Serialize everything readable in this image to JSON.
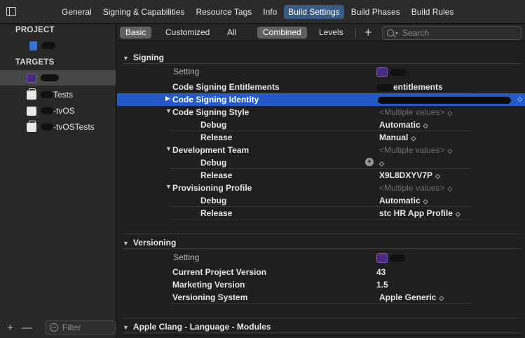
{
  "tabs": [
    "General",
    "Signing & Capabilities",
    "Resource Tags",
    "Info",
    "Build Settings",
    "Build Phases",
    "Build Rules"
  ],
  "active_tab": "Build Settings",
  "sidebar": {
    "project_header": "PROJECT",
    "targets_header": "TARGETS",
    "targets": [
      {
        "label": ""
      },
      {
        "label": "Tests"
      },
      {
        "label": "-tvOS"
      },
      {
        "label": "-tvOSTests"
      }
    ],
    "filter_placeholder": "Filter"
  },
  "filterbar": {
    "basic": "Basic",
    "customized": "Customized",
    "all": "All",
    "combined": "Combined",
    "levels": "Levels",
    "search_placeholder": "Search"
  },
  "signing": {
    "title": "Signing",
    "setting_label": "Setting",
    "entitlements_key": "Code Signing Entitlements",
    "entitlements_val": "entitlements",
    "identity_key": "Code Signing Identity",
    "style_key": "Code Signing Style",
    "style_val": "<Multiple values>",
    "debug": "Debug",
    "release": "Release",
    "style_debug": "Automatic",
    "style_release": "Manual",
    "team_key": "Development Team",
    "team_val": "<Multiple values>",
    "team_release": "X9L8DXYV7P",
    "profile_key": "Provisioning Profile",
    "profile_val": "<Multiple values>",
    "profile_debug": "Automatic",
    "profile_release": "stc HR App Profile"
  },
  "versioning": {
    "title": "Versioning",
    "setting_label": "Setting",
    "current_key": "Current Project Version",
    "current_val": "43",
    "marketing_key": "Marketing Version",
    "marketing_val": "1.5",
    "system_key": "Versioning System",
    "system_val": "Apple Generic"
  },
  "apple_clang": {
    "title": "Apple Clang - Language - Modules"
  }
}
